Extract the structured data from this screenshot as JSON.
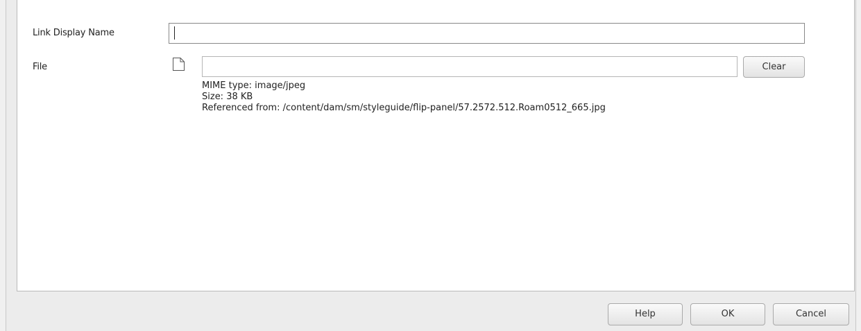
{
  "form": {
    "display_name_label": "Link Display Name",
    "display_name_value": "",
    "file_label": "File",
    "file_value": "",
    "clear_label": "Clear",
    "file_info": {
      "mime": "MIME type: image/jpeg",
      "size": "Size: 38 KB",
      "referenced": "Referenced from: /content/dam/sm/styleguide/flip-panel/57.2572.512.Roam0512_665.jpg"
    }
  },
  "footer": {
    "help_label": "Help",
    "ok_label": "OK",
    "cancel_label": "Cancel"
  },
  "icons": {
    "file": "file-icon"
  }
}
